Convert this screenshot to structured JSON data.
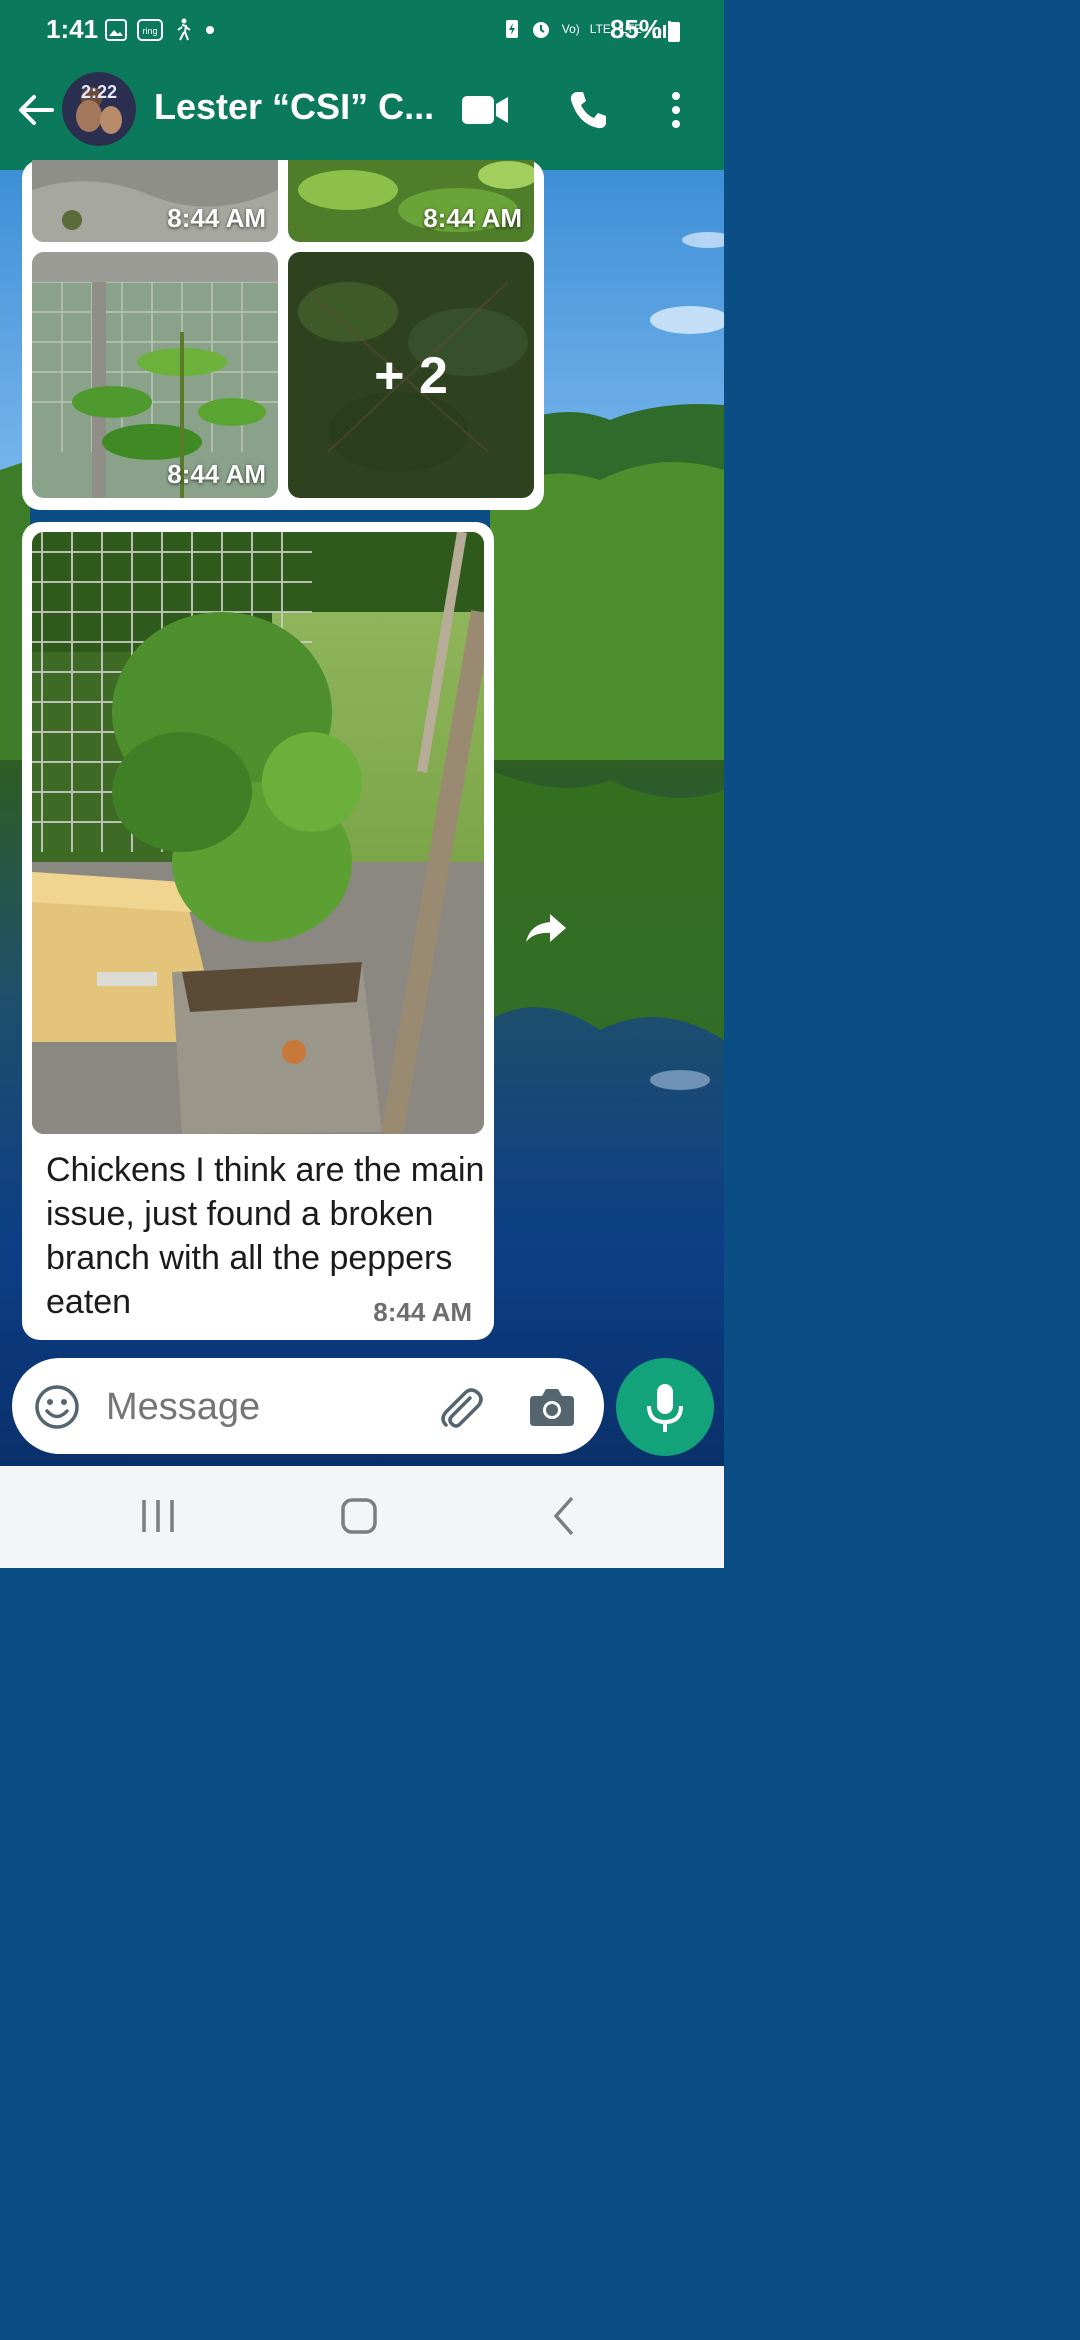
{
  "status_bar": {
    "time": "1:41",
    "battery": "85%",
    "network_labels": [
      "Vo)",
      "LTE",
      "LTE"
    ]
  },
  "app_bar": {
    "avatar_time": "2:22",
    "title": "Lester “CSI” C..."
  },
  "album": {
    "tiles": [
      {
        "time": "8:44 AM"
      },
      {
        "time": "8:44 AM"
      },
      {
        "time": "8:44 AM"
      },
      {
        "more": "+ 2"
      }
    ]
  },
  "photo_message": {
    "caption": "Chickens I think are the main issue, just found a broken branch with all the peppers eaten",
    "time": "8:44 AM"
  },
  "composer": {
    "placeholder": "Message"
  },
  "colors": {
    "app_bar": "#0b7a5c",
    "mic_button": "#12a37a",
    "bubble": "#ffffff"
  },
  "icons": [
    "back-arrow-icon",
    "video-call-icon",
    "phone-icon",
    "more-vert-icon",
    "forward-icon",
    "emoji-icon",
    "attach-icon",
    "camera-icon",
    "mic-icon",
    "recents-icon",
    "home-icon",
    "back-nav-icon"
  ]
}
